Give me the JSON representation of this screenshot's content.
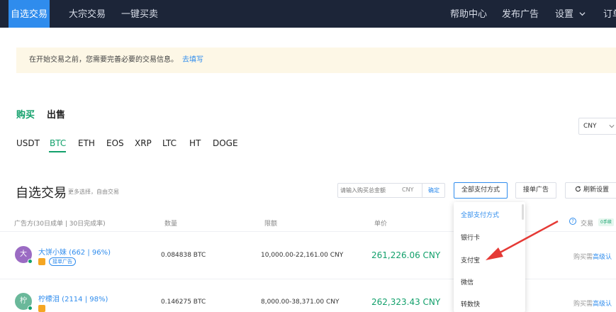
{
  "nav": {
    "left": [
      "自选交易",
      "大宗交易",
      "一键买卖"
    ],
    "right": [
      "帮助中心",
      "发布广告",
      "设置",
      "订单"
    ]
  },
  "notice": {
    "text": "在开始交易之前，您需要完善必要的交易信息。",
    "link": "去填写"
  },
  "trade_tabs": [
    "购买",
    "出售"
  ],
  "coins": [
    "USDT",
    "BTC",
    "ETH",
    "EOS",
    "XRP",
    "LTC",
    "HT",
    "DOGE"
  ],
  "currency": "CNY",
  "section": {
    "title": "自选交易",
    "subtitle": "更多选择，自由交易"
  },
  "search": {
    "placeholder": "请输入购买总金额",
    "unit": "CNY",
    "confirm": "确定"
  },
  "buttons": {
    "payment": "全部支付方式",
    "accept_ads": "接单广告",
    "refresh": "刷新设置"
  },
  "columns": {
    "advertiser": "广告方(30日成单 | 30日完成率)",
    "quantity": "数量",
    "limit": "限额",
    "price": "单价",
    "trade": "交易",
    "zero_fee": "0手续"
  },
  "rows": [
    {
      "avatar": "大",
      "avatar_color": "#9b6bc3",
      "name": "大饼小妹 (662 | 96%)",
      "tag": "接单广告",
      "quantity": "0.084838 BTC",
      "limit": "10,000.00-22,161.00 CNY",
      "price": "261,226.06 CNY",
      "action_prefix": "购买需",
      "action_link": "高级认"
    },
    {
      "avatar": "柠",
      "avatar_color": "#6ab89a",
      "name": "柠檬泪 (2114 | 98%)",
      "quantity": "0.146275 BTC",
      "limit": "8,000.00-38,371.00 CNY",
      "price": "262,323.43 CNY",
      "action_prefix": "购买需",
      "action_link": "高级认"
    }
  ],
  "payment_options": [
    "全部支付方式",
    "银行卡",
    "支付宝",
    "微信",
    "转数快"
  ],
  "colors": {
    "nav_bg": "#1c2538",
    "accent": "#2f8ced",
    "green": "#12a06b",
    "arrow": "#e53935"
  }
}
